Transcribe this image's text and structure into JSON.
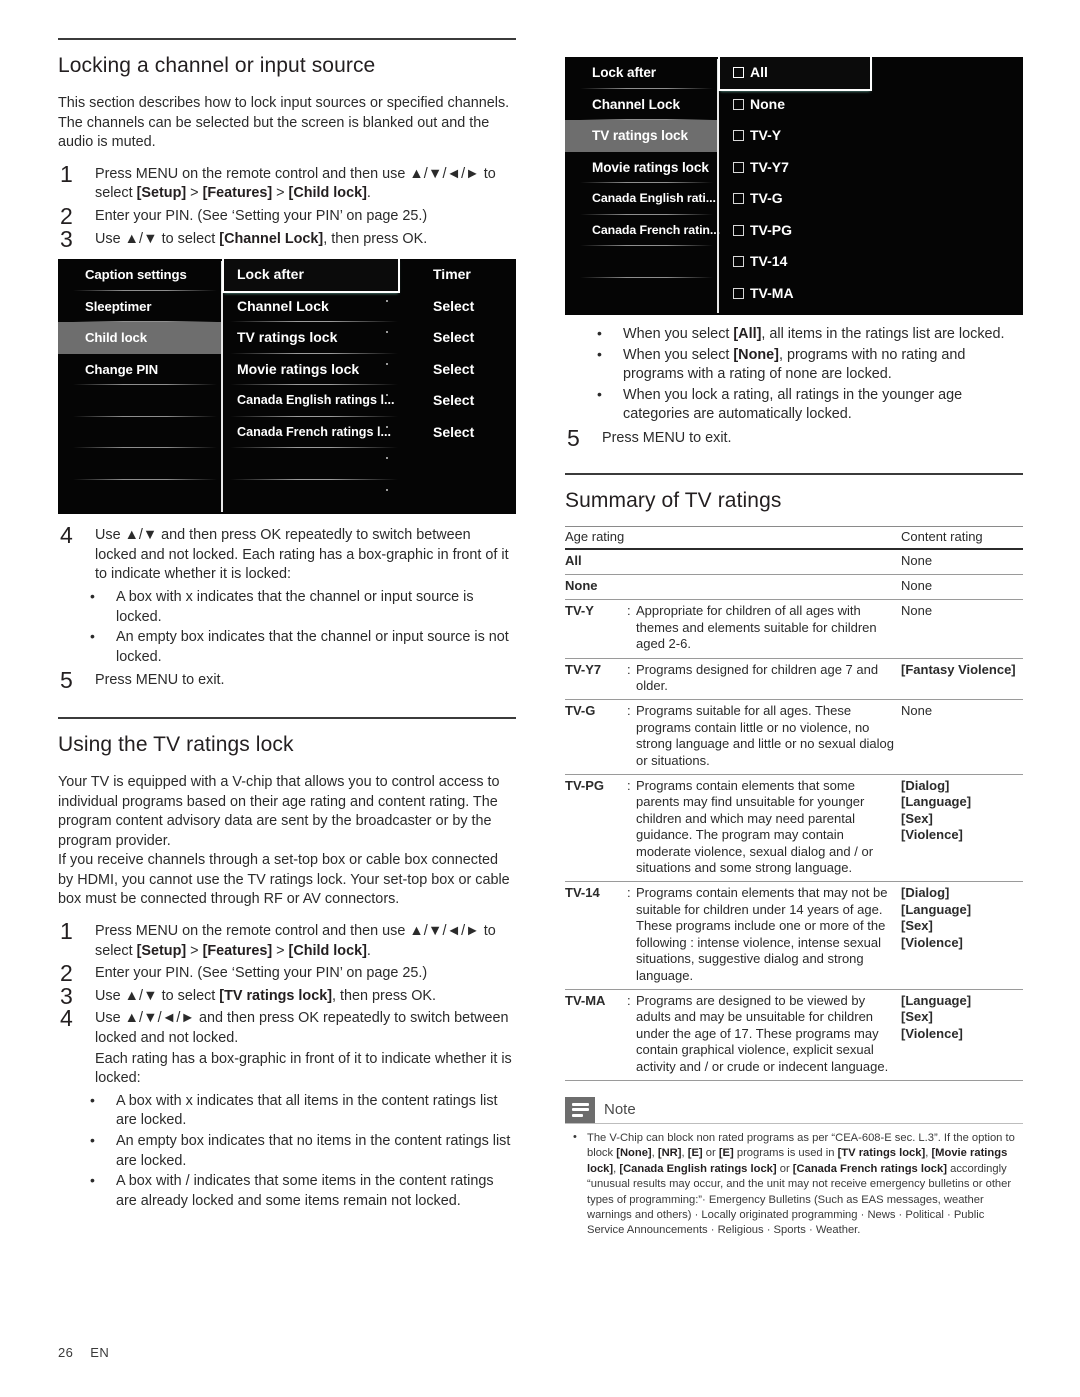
{
  "page": {
    "number": "26",
    "language": "EN"
  },
  "left": {
    "section1": {
      "title": "Locking a channel or input source",
      "intro": "This section describes how to lock input sources or specified channels. The channels can be selected but the screen is blanked out and the audio is muted.",
      "steps": [
        {
          "num": "1",
          "text_a": "Press MENU on the remote control and then use ",
          "keys": "▲/▼/◄/►",
          "text_b": " to select ",
          "br1": "[Setup]",
          "sep1": " > ",
          "br2": "[Features]",
          "sep2": " > ",
          "br3": "[Child lock]",
          "tail": "."
        },
        {
          "num": "2",
          "text": "Enter your PIN. (See ‘Setting your PIN’ on page 25.)"
        },
        {
          "num": "3",
          "text_a": "Use ",
          "keys": "▲/▼",
          "text_b": " to select ",
          "br1": "[Channel Lock]",
          "tail": ", then press OK."
        }
      ],
      "step4": {
        "num": "4",
        "text": "Use ▲/▼ and then press OK repeatedly to switch between locked and not locked. Each rating has a box-graphic in front of it to indicate whether it is locked:",
        "bullets": [
          "A box with x indicates that the channel or input source is locked.",
          "An empty box indicates that the channel or input source is not locked."
        ]
      },
      "step5": {
        "num": "5",
        "text": "Press MENU to exit."
      }
    },
    "osd1": {
      "left_items": [
        {
          "label": "Caption settings",
          "selected": false
        },
        {
          "label": "Sleeptimer",
          "selected": false
        },
        {
          "label": "Child lock",
          "selected": true
        },
        {
          "label": "Change PIN",
          "selected": false
        },
        {
          "label": "",
          "selected": false
        },
        {
          "label": "",
          "selected": false
        },
        {
          "label": "",
          "selected": false
        },
        {
          "label": "",
          "selected": false
        }
      ],
      "mid_items": [
        {
          "label": "Lock after",
          "highlighted": true,
          "dot": false
        },
        {
          "label": "Channel Lock",
          "highlighted": false,
          "dot": true
        },
        {
          "label": "TV ratings lock",
          "highlighted": false,
          "dot": true
        },
        {
          "label": "Movie ratings lock",
          "highlighted": false,
          "dot": true
        },
        {
          "label": "Canada English ratings l...",
          "highlighted": false,
          "dot": true
        },
        {
          "label": "Canada French ratings l...",
          "highlighted": false,
          "dot": true
        },
        {
          "label": "",
          "highlighted": false,
          "dot": true
        },
        {
          "label": "",
          "highlighted": false,
          "dot": true
        }
      ],
      "right_items": [
        {
          "label": "Timer"
        },
        {
          "label": "Select"
        },
        {
          "label": "Select"
        },
        {
          "label": "Select"
        },
        {
          "label": "Select"
        },
        {
          "label": "Select"
        },
        {
          "label": ""
        },
        {
          "label": ""
        }
      ]
    },
    "section2": {
      "title": "Using the TV ratings lock",
      "para1": "Your TV is equipped with a V-chip that allows you to control access to individual programs based on their age rating and content rating. The program content advisory data are sent by the broadcaster or by the program provider.",
      "para2": "If you receive channels through a set-top box or cable box connected by HDMI, you cannot use the TV ratings lock. Your set-top box or cable box must be connected through RF or AV connectors.",
      "steps": [
        {
          "num": "1",
          "text_a": "Press MENU on the remote control and then use ",
          "keys": "▲/▼/◄/►",
          "text_b": " to select ",
          "br1": "[Setup]",
          "sep1": " > ",
          "br2": "[Features]",
          "sep2": " > ",
          "br3": "[Child lock]",
          "tail": "."
        },
        {
          "num": "2",
          "text": "Enter your PIN. (See ‘Setting your PIN’ on page 25.)"
        },
        {
          "num": "3",
          "text_a": "Use ",
          "keys": "▲/▼",
          "text_b": " to select ",
          "br1": "[TV ratings lock]",
          "tail": ", then press OK."
        }
      ],
      "step4": {
        "num": "4",
        "line1_a": "Use ",
        "line1_keys": "▲/▼/◄/►",
        "line1_b": " and then press OK repeatedly to switch between locked and not locked.",
        "line2": "Each rating has a box-graphic in front of it to indicate whether it is locked:",
        "bullets": [
          "A box with x indicates that all items in the content ratings list are locked.",
          "An empty box indicates that no items in the content ratings list are locked.",
          "A box with / indicates that some items in the content ratings are already locked and some items remain not locked."
        ]
      }
    }
  },
  "right": {
    "osd2": {
      "left_items": [
        {
          "label": "Lock after",
          "selected": false
        },
        {
          "label": "Channel Lock",
          "selected": false
        },
        {
          "label": "TV ratings lock",
          "selected": true
        },
        {
          "label": "Movie ratings lock",
          "selected": false
        },
        {
          "label": "Canada English rati...",
          "selected": false
        },
        {
          "label": "Canada French ratin...",
          "selected": false
        },
        {
          "label": "",
          "selected": false
        },
        {
          "label": "",
          "selected": false
        }
      ],
      "options": [
        {
          "label": "All",
          "highlighted": true,
          "checked": false
        },
        {
          "label": "None",
          "highlighted": false,
          "checked": false
        },
        {
          "label": "TV-Y",
          "highlighted": false,
          "checked": false
        },
        {
          "label": "TV-Y7",
          "highlighted": false,
          "checked": false
        },
        {
          "label": "TV-G",
          "highlighted": false,
          "checked": false
        },
        {
          "label": "TV-PG",
          "highlighted": false,
          "checked": false
        },
        {
          "label": "TV-14",
          "highlighted": false,
          "checked": false
        },
        {
          "label": "TV-MA",
          "highlighted": false,
          "checked": false
        }
      ]
    },
    "bullets": [
      {
        "pre": "When you select ",
        "br": "[All]",
        "post": ", all items in the ratings list are locked."
      },
      {
        "pre": "When you select ",
        "br": "[None]",
        "post": ", programs with no rating and programs with a rating of none are locked."
      },
      {
        "pre": "When you lock a rating, all ratings in the younger age categories are automatically locked.",
        "br": "",
        "post": ""
      }
    ],
    "step5": {
      "num": "5",
      "text": "Press MENU to exit."
    },
    "summary": {
      "title": "Summary of TV ratings",
      "headers": {
        "age": "Age rating",
        "content": "Content rating"
      },
      "rows": [
        {
          "rating": "All",
          "colon": "",
          "desc": "",
          "content": "None",
          "content_bold": false
        },
        {
          "rating": "None",
          "colon": "",
          "desc": "",
          "content": "None",
          "content_bold": false
        },
        {
          "rating": "TV-Y",
          "colon": ":",
          "desc": "Appropriate for children of all ages with themes and elements suitable for children aged 2-6.",
          "content": "None",
          "content_bold": false
        },
        {
          "rating": "TV-Y7",
          "colon": ":",
          "desc": "Programs designed for children age 7 and older.",
          "content": "[Fantasy Violence]",
          "content_bold": true
        },
        {
          "rating": "TV-G",
          "colon": ":",
          "desc": "Programs suitable for all ages. These programs contain little or no violence, no strong language and little or no sexual dialog or situations.",
          "content": "None",
          "content_bold": false
        },
        {
          "rating": "TV-PG",
          "colon": ":",
          "desc": "Programs contain elements that some parents may find unsuitable for younger children and which may need parental guidance. The program may contain moderate violence, sexual dialog and / or situations and some strong language.",
          "content": "[Dialog]\n[Language]\n[Sex]\n[Violence]",
          "content_bold": true
        },
        {
          "rating": "TV-14",
          "colon": ":",
          "desc": "Programs contain elements that may not be suitable for children under 14 years of age. These programs include one or more of the following : intense violence, intense sexual situations, suggestive dialog and strong language.",
          "content": "[Dialog]\n[Language]\n[Sex]\n[Violence]",
          "content_bold": true
        },
        {
          "rating": "TV-MA",
          "colon": ":",
          "desc": "Programs are designed to be viewed by adults and may be unsuitable for children under the age of 17. These programs may contain graphical violence, explicit sexual activity and / or crude or indecent language.",
          "content": "[Language]\n[Sex]\n[Violence]",
          "content_bold": true
        }
      ]
    },
    "note": {
      "label": "Note",
      "text_parts": {
        "p1": "The V-Chip can block non rated programs as per “CEA-608-E sec. L.3”. If the option to block ",
        "b1": "[None]",
        "p2": ", ",
        "b2": "[NR]",
        "p3": ", ",
        "b3": "[E]",
        "p4": " or ",
        "b4": "[E]",
        "p5": " programs is used in ",
        "b5": "[TV ratings lock]",
        "p6": ", ",
        "b6": "[Movie ratings lock]",
        "p7": ", ",
        "b7": "[Canada English ratings lock]",
        "p8": " or ",
        "b8": "[Canada French ratings lock]",
        "p9": " accordingly “unusual results may occur, and the unit may not receive emergency bulletins or other types of programming:”· Emergency Bulletins (Such as EAS messages, weather warnings and others) · Locally originated programming · News · Political · Public Service Announcements · Religious · Sports · Weather."
      }
    }
  },
  "colors": {
    "osd_highlight": "#7fd6c2",
    "osd_selected_row": "#6e6e6e",
    "note_icon_bg": "#6d6d6d"
  }
}
